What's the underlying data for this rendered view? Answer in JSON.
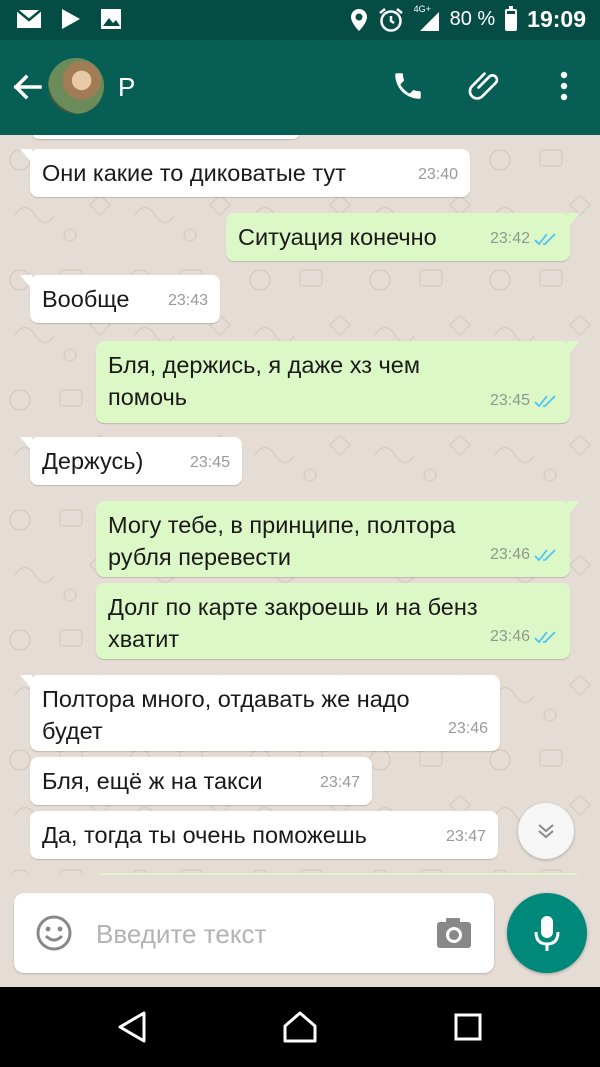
{
  "status_bar": {
    "icons": [
      "mail-icon",
      "play-store-icon",
      "gallery-icon",
      "location-icon",
      "alarm-icon",
      "signal-icon",
      "battery-icon"
    ],
    "network_label": "4G+",
    "battery_percent": "80 %",
    "battery_level": 0.8,
    "time": "19:09"
  },
  "header": {
    "contact_name": "P",
    "icons": [
      "back-arrow-icon",
      "avatar",
      "phone-icon",
      "attach-icon",
      "more-vert-icon"
    ]
  },
  "messages": [
    {
      "dir": "in",
      "text": "Они какие то диковатые тут",
      "time": "23:40"
    },
    {
      "dir": "out",
      "text": "Ситуация конечно",
      "time": "23:42",
      "read": true
    },
    {
      "dir": "in",
      "text": "Вообще",
      "time": "23:43"
    },
    {
      "dir": "out",
      "text": "Бля, держись, я даже хз чем помочь",
      "time": "23:45",
      "read": true
    },
    {
      "dir": "in",
      "text": "Держусь)",
      "time": "23:45"
    },
    {
      "dir": "out",
      "text": "Могу тебе, в принципе, полтора рубля перевести",
      "time": "23:46",
      "read": true
    },
    {
      "dir": "out",
      "text": "Долг по карте закроешь и на бенз хватит",
      "time": "23:46",
      "read": true
    },
    {
      "dir": "in",
      "text": "Полтора много, отдавать же надо будет",
      "time": "23:46"
    },
    {
      "dir": "in",
      "text": "Бля, ещё ж на такси",
      "time": "23:47"
    },
    {
      "dir": "in",
      "text": "Да, тогда ты очень поможешь",
      "time": "23:47"
    }
  ],
  "composer": {
    "placeholder": "Введите текст",
    "icons": [
      "emoji-icon",
      "camera-icon",
      "mic-icon"
    ]
  },
  "colors": {
    "status_bar": "#054d44",
    "app_bar": "#075e54",
    "outgoing_bubble": "#dcf8c6",
    "incoming_bubble": "#ffffff",
    "chat_background": "#e5ddd5",
    "mic_button": "#00897b",
    "read_ticks": "#4fc3f7"
  },
  "nav_bar": {
    "icons": [
      "back-triangle-icon",
      "home-icon",
      "recents-icon"
    ]
  }
}
